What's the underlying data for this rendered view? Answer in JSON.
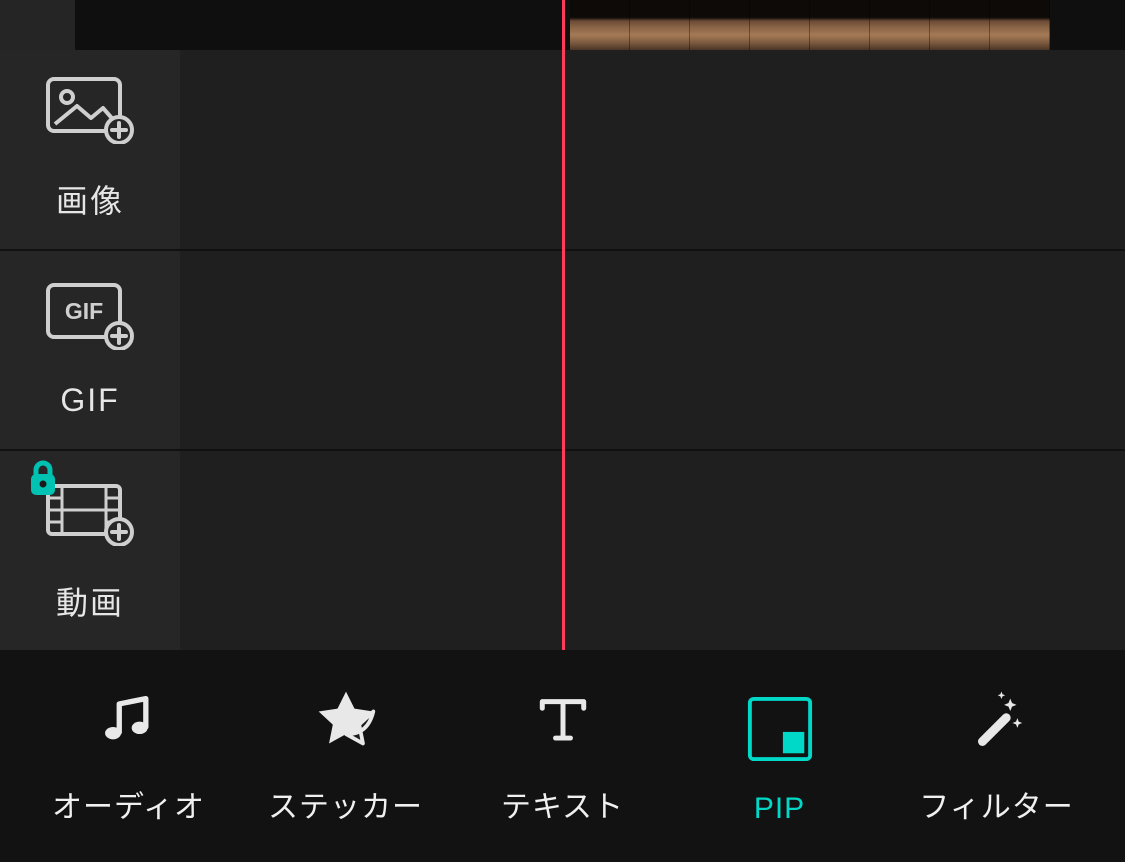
{
  "colors": {
    "accent": "#00d8c8",
    "playhead": "#ff3b5c",
    "lockBadge": "#00c2b2"
  },
  "sidebar": {
    "items": [
      {
        "label": "画像",
        "icon": "image-add-icon",
        "locked": false
      },
      {
        "label": "GIF",
        "icon": "gif-add-icon",
        "locked": false
      },
      {
        "label": "動画",
        "icon": "video-add-icon",
        "locked": true
      }
    ]
  },
  "timeline": {
    "trackCount": 3
  },
  "toolbar": {
    "items": [
      {
        "label": "オーディオ",
        "icon": "music-icon",
        "active": false
      },
      {
        "label": "ステッカー",
        "icon": "sticker-icon",
        "active": false
      },
      {
        "label": "テキスト",
        "icon": "text-icon",
        "active": false
      },
      {
        "label": "PIP",
        "icon": "pip-icon",
        "active": true
      },
      {
        "label": "フィルター",
        "icon": "wand-icon",
        "active": false
      }
    ]
  },
  "gifBadgeText": "GIF"
}
